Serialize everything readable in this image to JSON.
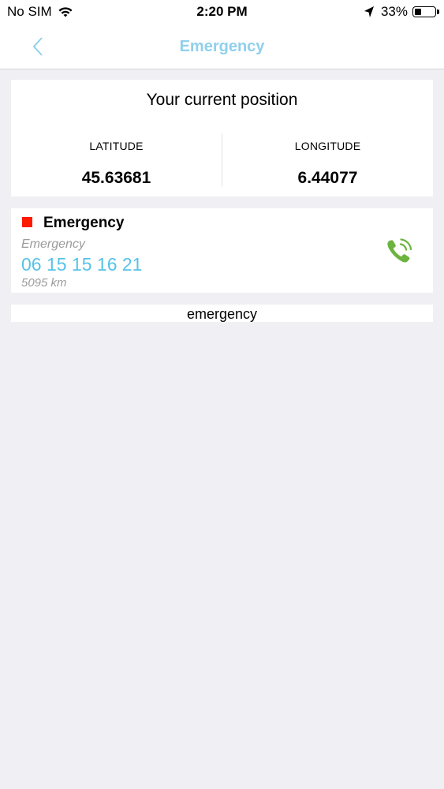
{
  "status_bar": {
    "carrier": "No SIM",
    "time": "2:20 PM",
    "battery_percent": "33%",
    "battery_level": 0.33
  },
  "nav": {
    "title": "Emergency",
    "title_color": "#8fd0ec"
  },
  "position": {
    "title": "Your current position",
    "latitude_label": "LATITUDE",
    "latitude_value": "45.63681",
    "longitude_label": "LONGITUDE",
    "longitude_value": "6.44077"
  },
  "emergency_contact": {
    "name": "Emergency",
    "marker_color": "#ff1a00",
    "subtitle": "Emergency",
    "phone": "06 15 15 16 21",
    "phone_color": "#56c2e8",
    "distance": "5095 km",
    "call_icon_color": "#6db33f"
  },
  "emergency_bar": {
    "label": "emergency"
  }
}
